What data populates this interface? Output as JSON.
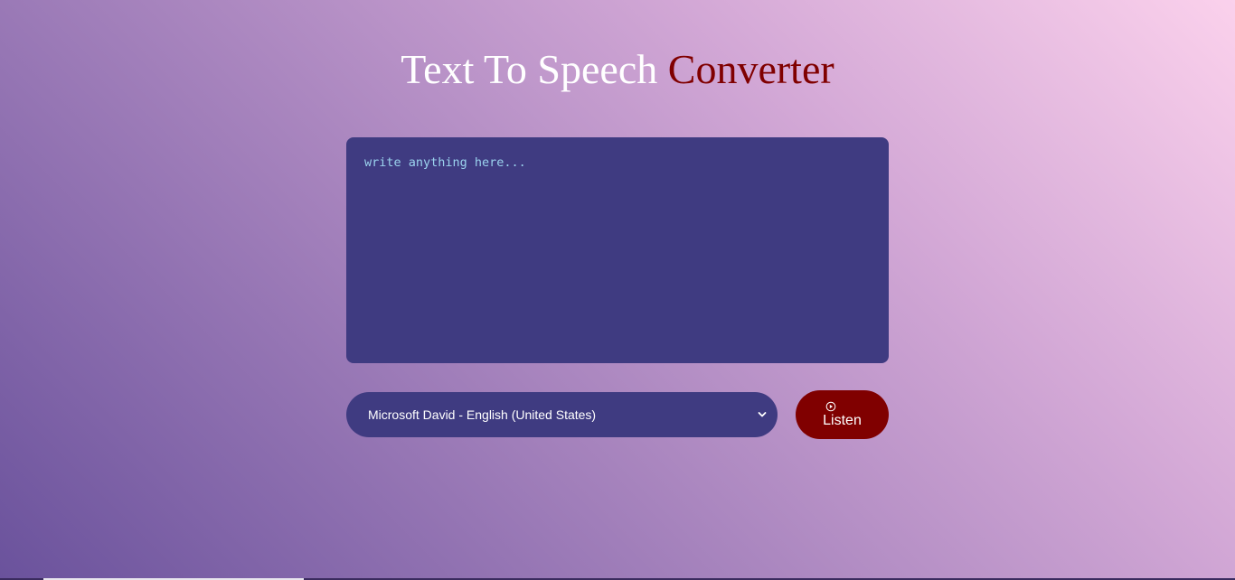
{
  "header": {
    "title_part1": "Text To Speech",
    "title_part2": "Converter",
    "title_part1_color": "#ffffff",
    "title_part2_color": "#800000"
  },
  "editor": {
    "placeholder": "write anything here...",
    "value": ""
  },
  "voice_select": {
    "selected": "Microsoft David - English (United States)",
    "icon": "chevron-down-icon"
  },
  "listen_button": {
    "label": "Listen",
    "icon": "play-circle-icon",
    "color": "#800000"
  },
  "colors": {
    "panel": "#3f3b81",
    "placeholder_text": "#9bd3ee"
  }
}
